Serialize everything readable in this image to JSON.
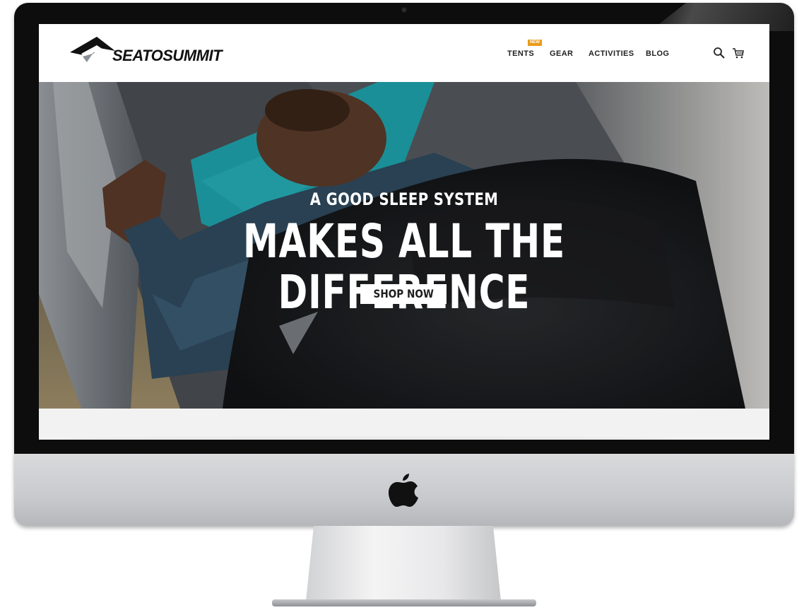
{
  "brand": {
    "name": "SEATOSUMMIT"
  },
  "nav": {
    "items": [
      {
        "label": "TENTS"
      },
      {
        "label": "GEAR"
      },
      {
        "label": "ACTIVITIES"
      },
      {
        "label": "BLOG"
      }
    ],
    "badge": "NEW"
  },
  "header_icons": {
    "search": "search-icon",
    "cart": "cart-icon"
  },
  "hero": {
    "subtitle": "A GOOD SLEEP SYSTEM",
    "title": "MAKES ALL THE DIFFERENCE",
    "cta_label": "SHOP NOW"
  },
  "colors": {
    "badge": "#e89b1c",
    "pillow": "#1fa3ad",
    "header_bg": "#ffffff",
    "cta_bg": "#ffffff"
  }
}
